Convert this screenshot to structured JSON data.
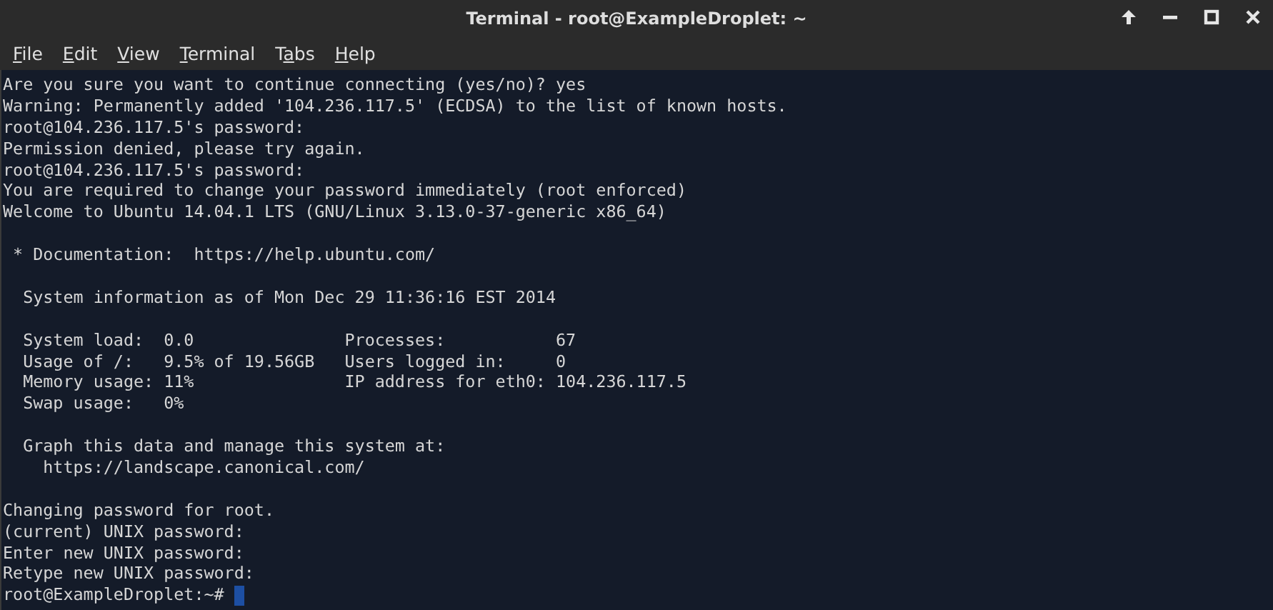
{
  "window": {
    "title": "Terminal - root@ExampleDroplet: ~",
    "controls": [
      {
        "kind": "keep-above"
      },
      {
        "kind": "minimize"
      },
      {
        "kind": "maximize"
      },
      {
        "kind": "close"
      }
    ]
  },
  "menu": [
    {
      "mnemonic": "F",
      "rest": "ile"
    },
    {
      "mnemonic": "E",
      "rest": "dit"
    },
    {
      "mnemonic": "V",
      "rest": "iew"
    },
    {
      "mnemonic": "T",
      "rest": "erminal"
    },
    {
      "lead": "T",
      "mnemonic": "a",
      "rest": "bs"
    },
    {
      "mnemonic": "H",
      "rest": "elp"
    }
  ],
  "terminal": {
    "blocks": [
      [
        "Are you sure you want to continue connecting (yes/no)? yes",
        "Warning: Permanently added '104.236.117.5' (ECDSA) to the list of known hosts.",
        "root@104.236.117.5's password:",
        "Permission denied, please try again.",
        "root@104.236.117.5's password:",
        "You are required to change your password immediately (root enforced)",
        "Welcome to Ubuntu 14.04.1 LTS (GNU/Linux 3.13.0-37-generic x86_64)"
      ],
      [
        " * Documentation:  https://help.ubuntu.com/"
      ],
      [
        "  System information as of Mon Dec 29 11:36:16 EST 2014"
      ],
      [
        "  System load:  0.0               Processes:           67",
        "  Usage of /:   9.5% of 19.56GB   Users logged in:     0",
        "  Memory usage: 11%               IP address for eth0: 104.236.117.5",
        "  Swap usage:   0%"
      ],
      [
        "  Graph this data and manage this system at:",
        "    https://landscape.canonical.com/"
      ],
      [
        "Changing password for root.",
        "(current) UNIX password:",
        "Enter new UNIX password:",
        "Retype new UNIX password:"
      ]
    ],
    "prompt": {
      "text": "root@ExampleDroplet:~#",
      "cursor": true
    }
  }
}
